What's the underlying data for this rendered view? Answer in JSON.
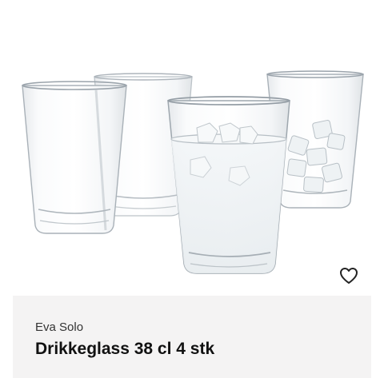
{
  "product": {
    "brand": "Eva Solo",
    "title": "Drikkeglass 38 cl 4 stk",
    "image_icon": "drinking-glasses-image"
  },
  "actions": {
    "favorite_icon": "heart-outline-icon"
  },
  "colors": {
    "info_background": "#f4f3f3",
    "title_text": "#111111",
    "brand_text": "#333333"
  }
}
